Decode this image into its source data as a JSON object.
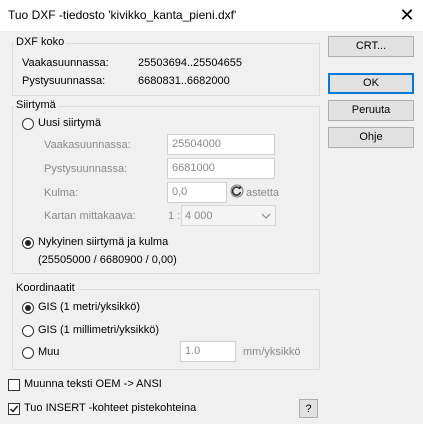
{
  "window": {
    "title": "Tuo DXF -tiedosto 'kivikko_kanta_pieni.dxf'",
    "close_glyph": "✕"
  },
  "dxf_size": {
    "legend": "DXF koko",
    "horizontal_label": "Vaakasuunnassa:",
    "horizontal_value": "25503694..25504655",
    "vertical_label": "Pystysuunnassa:",
    "vertical_value": "6680831..6682000"
  },
  "shift": {
    "legend": "Siirtymä",
    "new_shift_label": "Uusi siirtymä",
    "horizontal_label": "Vaakasuunnassa:",
    "horizontal_value": "25504000",
    "vertical_label": "Pystysuunnassa:",
    "vertical_value": "6681000",
    "angle_label": "Kulma:",
    "angle_value": "0,0",
    "angle_unit": "astetta",
    "scale_label": "Kartan mittakaava:",
    "scale_prefix": "1 :",
    "scale_value": "4 000",
    "current_shift_label": "Nykyinen siirtymä ja kulma",
    "current_shift_value": "(25505000 / 6680900 / 0,00)",
    "selected": "current"
  },
  "coordinates": {
    "legend": "Koordinaatit",
    "gis_meter_label": "GIS (1 metri/yksikkö)",
    "gis_mm_label": "GIS (1 millimetri/yksikkö)",
    "other_label": "Muu",
    "other_value": "1.0",
    "other_unit": "mm/yksikkö",
    "selected": "gis_meter"
  },
  "options": {
    "convert_oem_label": "Muunna teksti OEM -> ANSI",
    "convert_oem_checked": false,
    "insert_points_label": "Tuo INSERT -kohteet pistekohteina",
    "insert_points_checked": true
  },
  "buttons": {
    "crt": "CRT...",
    "ok": "OK",
    "cancel": "Peruuta",
    "help": "Ohje",
    "question": "?"
  },
  "colors": {
    "default_button_border": "#0078d7",
    "disabled_text": "#8a8a8a",
    "dialog_background": "#f0f0f0"
  }
}
